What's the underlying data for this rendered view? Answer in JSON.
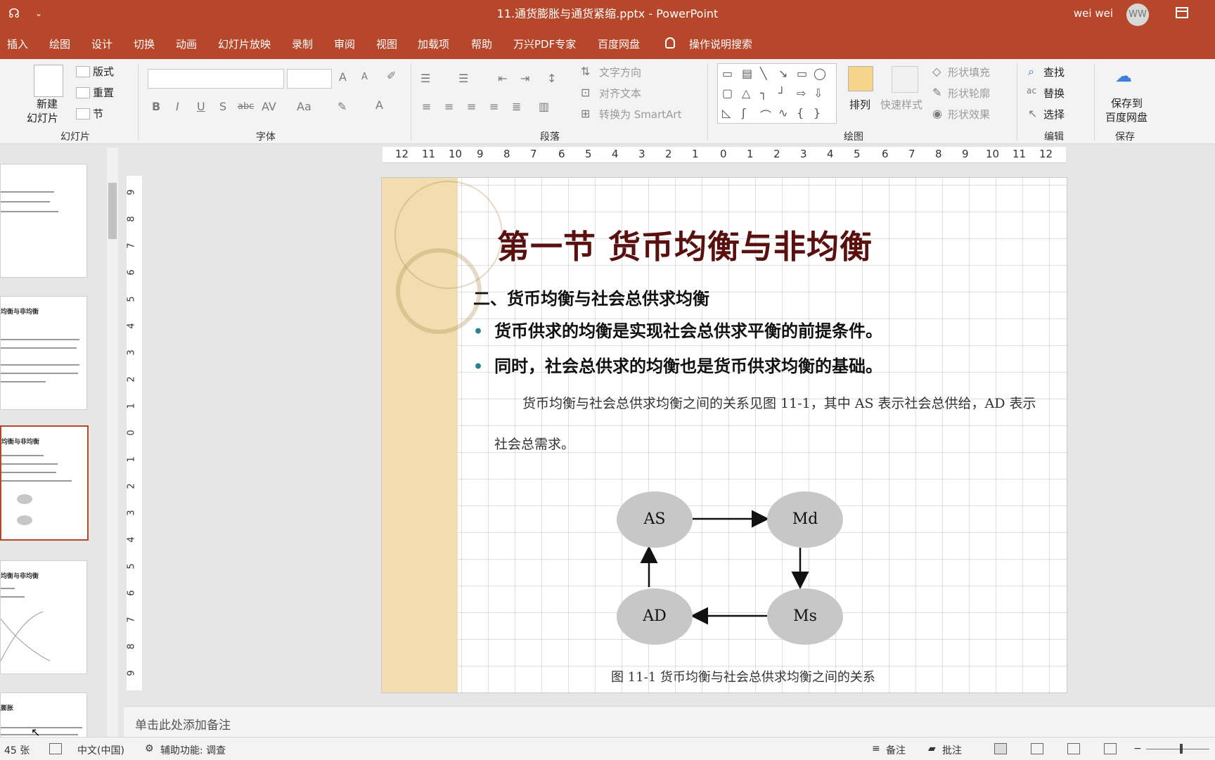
{
  "titlebar": {
    "title": "11.通货膨胀与通货紧缩.pptx  -  PowerPoint",
    "user": "wei wei",
    "avatar_initials": "WW",
    "qat_arrow": "⌄"
  },
  "menu": {
    "items": [
      "插入",
      "绘图",
      "设计",
      "切换",
      "动画",
      "幻灯片放映",
      "录制",
      "审阅",
      "视图",
      "加载项",
      "帮助",
      "万兴PDF专家",
      "百度网盘"
    ],
    "search": "操作说明搜索"
  },
  "ribbon": {
    "slides_group": {
      "label": "幻灯片",
      "new_slide_1": "新建",
      "new_slide_2": "幻灯片",
      "layout": "版式",
      "reset": "重置",
      "section": "节"
    },
    "font_group": {
      "label": "字体",
      "bold": "B",
      "italic": "I",
      "underline": "U",
      "shadow": "S",
      "strike": "abc",
      "spacing": "AV",
      "case": "Aa",
      "grow": "A",
      "shrink": "A",
      "color": "A"
    },
    "paragraph_group": {
      "label": "段落",
      "text_direction": "文字方向",
      "align_text": "对齐文本",
      "smartart": "转换为 SmartArt"
    },
    "drawing_group": {
      "label": "绘图",
      "arrange": "排列",
      "quick_styles": "快速样式",
      "shape_fill": "形状填充",
      "shape_outline": "形状轮廓",
      "shape_effects": "形状效果"
    },
    "edit_group": {
      "label": "编辑",
      "find": "查找",
      "replace": "替换",
      "select": "选择"
    },
    "save_group": {
      "label": "保存",
      "save_1": "保存到",
      "save_2": "百度网盘"
    }
  },
  "thumbnails": [
    {
      "title": "",
      "lines": 3
    },
    {
      "title": "均衡与非均衡",
      "lines": 5
    },
    {
      "title": "均衡与非均衡",
      "lines": 4,
      "selected": true
    },
    {
      "title": "均衡与非均衡",
      "lines": 3
    },
    {
      "title": "膨胀",
      "lines": 2
    }
  ],
  "ruler_h": [
    "12",
    "11",
    "10",
    "9",
    "8",
    "7",
    "6",
    "5",
    "4",
    "3",
    "2",
    "1",
    "0",
    "1",
    "2",
    "3",
    "4",
    "5",
    "6",
    "7",
    "8",
    "9",
    "10",
    "11",
    "12"
  ],
  "ruler_v": [
    "9",
    "8",
    "7",
    "6",
    "5",
    "4",
    "3",
    "2",
    "1",
    "0",
    "1",
    "2",
    "3",
    "4",
    "5",
    "6",
    "7",
    "8",
    "9"
  ],
  "slide": {
    "title": "第一节  货币均衡与非均衡",
    "subtitle": "二、货币均衡与社会总供求均衡",
    "bullets": [
      "货币供求的均衡是实现社会总供求平衡的前提条件。",
      "同时，社会总供求的均衡也是货币供求均衡的基础。"
    ],
    "paragraph_line1": "货币均衡与社会总供求均衡之间的关系见图 11-1，其中 AS 表示社会总供给，AD 表示",
    "paragraph_line2": "社会总需求。",
    "diagram": {
      "nodes": {
        "as": "AS",
        "md": "Md",
        "ad": "AD",
        "ms": "Ms"
      },
      "caption": "图 11-1   货币均衡与社会总供求均衡之间的关系"
    }
  },
  "notes_placeholder": "单击此处添加备注",
  "status": {
    "slide_count": "45 张",
    "language": "中文(中国)",
    "accessibility": "辅助功能: 调查",
    "notes": "备注",
    "comments": "批注"
  }
}
